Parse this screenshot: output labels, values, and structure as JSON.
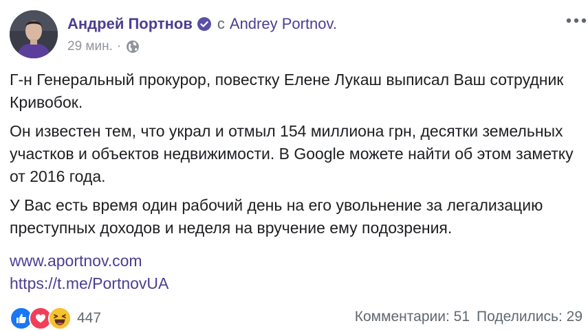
{
  "post": {
    "author": "Андрей Портнов",
    "with_prefix": "с",
    "with_name": "Andrey Portnov.",
    "time": "29 мин.",
    "separator": "·",
    "privacy_icon": "globe-icon",
    "verified_icon": "verified-badge-icon",
    "more_icon": "more-options-icon",
    "paragraphs": [
      "Г-н Генеральный прокурор, повестку Елене Лукаш выписал Ваш сотрудник Кривобок.",
      "Он известен тем, что украл и отмыл 154 миллиона грн, десятки земельных участков и объектов недвижимости. В Google можете найти об этом заметку от 2016 года.",
      "У Вас есть время один рабочий день на его увольнение за легализацию преступных доходов и неделя на вручение ему подозрения."
    ],
    "links": [
      "www.aportnov.com",
      "https://t.me/PortnovUA"
    ]
  },
  "footer": {
    "reaction_icons": [
      "like-icon",
      "love-icon",
      "haha-icon"
    ],
    "reaction_count": "447",
    "comments": "Комментарии: 51",
    "shares": "Поделились: 29"
  },
  "colors": {
    "link": "#4a3e93",
    "like": "#1877f2",
    "love": "#f33e58",
    "haha": "#f7b125",
    "meta": "#90949c"
  }
}
